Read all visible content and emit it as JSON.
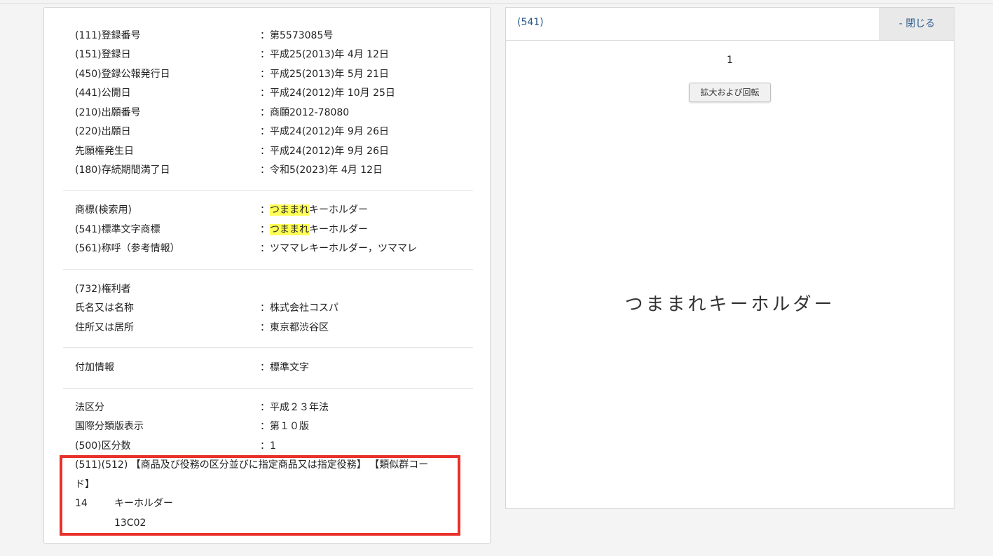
{
  "bibliographic": [
    {
      "label": "(111)登録番号",
      "value": "：第5573085号"
    },
    {
      "label": "(151)登録日",
      "value": "：平成25(2013)年 4月 12日"
    },
    {
      "label": "(450)登録公報発行日",
      "value": "：平成25(2013)年 5月 21日"
    },
    {
      "label": "(441)公開日",
      "value": "：平成24(2012)年 10月 25日"
    },
    {
      "label": "(210)出願番号",
      "value": "：商願2012-78080"
    },
    {
      "label": "(220)出願日",
      "value": "：平成24(2012)年 9月 26日"
    },
    {
      "label": "先願権発生日",
      "value": "：平成24(2012)年 9月 26日"
    },
    {
      "label": "(180)存続期間満了日",
      "value": "：令和5(2023)年 4月 12日"
    }
  ],
  "trademark": {
    "search_label": "商標(検索用)",
    "search_colon": "：",
    "search_highlight": "つままれ",
    "search_rest": "キーホルダー",
    "standard_label": "(541)標準文字商標",
    "standard_colon": "：",
    "standard_highlight": "つままれ",
    "standard_rest": "キーホルダー",
    "pronunciation_label": "(561)称呼（参考情報）",
    "pronunciation_value": "：ツママレキーホルダー，ツママレ"
  },
  "holder": {
    "heading": "(732)権利者",
    "name_label": "氏名又は名称",
    "name_value": "：株式会社コスパ",
    "address_label": "住所又は居所",
    "address_value": "：東京都渋谷区"
  },
  "additional": {
    "label": "付加情報",
    "value": "：標準文字"
  },
  "classification": [
    {
      "label": "法区分",
      "value": "：平成２３年法"
    },
    {
      "label": "国際分類版表示",
      "value": "：第１０版"
    },
    {
      "label": "(500)区分数",
      "value": "：1"
    }
  ],
  "goods": {
    "heading_line1": "(511)(512) 【商品及び役務の区分並びに指定商品又は指定役務】 【類似群コー",
    "heading_line2": "ド】",
    "class_number": "14",
    "goods_name": "キーホルダー",
    "similar_code": "13C02"
  },
  "image_panel": {
    "title": "(541)",
    "close_label": "- 閉じる",
    "page_number": "1",
    "zoom_button_label": "拡大および回転",
    "mark_text": "つままれキーホルダー"
  },
  "colors": {
    "highlight": "#ffff55",
    "annotation_box": "#e8312a",
    "link_blue": "#2a5a8c"
  }
}
